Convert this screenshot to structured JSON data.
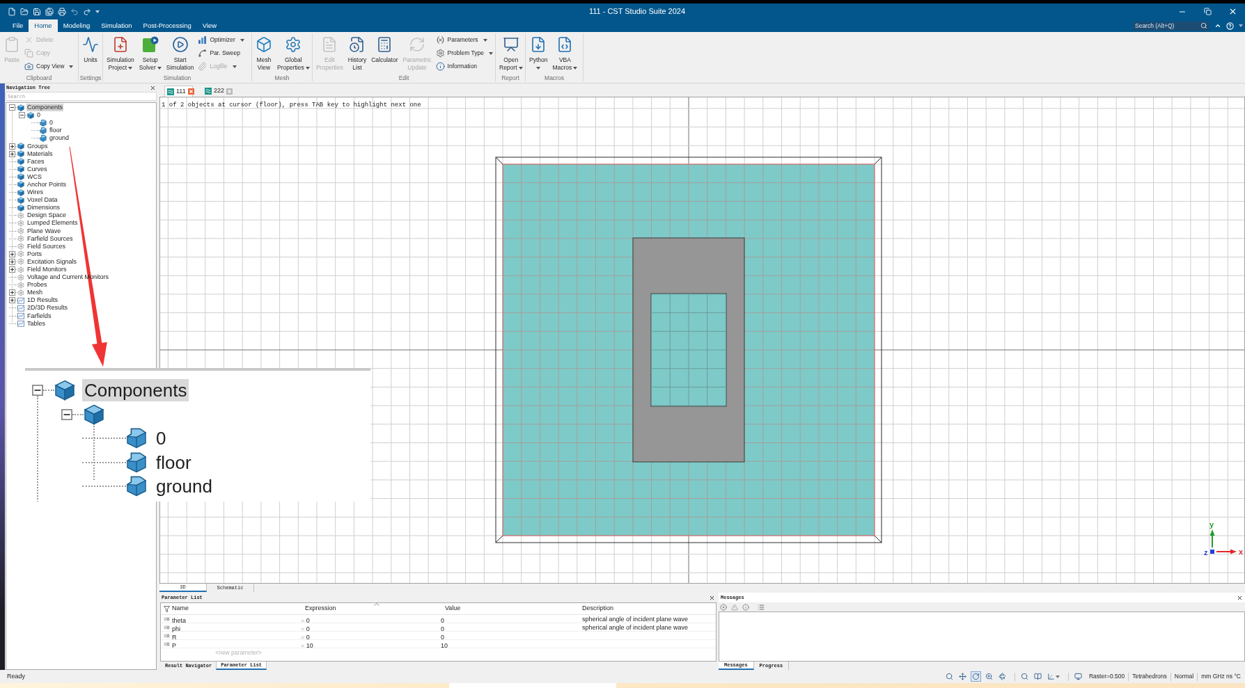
{
  "title_bar": {
    "title": "111 - CST Studio Suite 2024"
  },
  "menu_tabs": [
    {
      "label": "File",
      "selected": false
    },
    {
      "label": "Home",
      "selected": true
    },
    {
      "label": "Modeling",
      "selected": false
    },
    {
      "label": "Simulation",
      "selected": false
    },
    {
      "label": "Post-Processing",
      "selected": false
    },
    {
      "label": "View",
      "selected": false
    }
  ],
  "search": {
    "placeholder": "Search (Alt+Q)"
  },
  "ribbon": {
    "groups": [
      {
        "label": "Clipboard",
        "items": [
          {
            "kind": "large",
            "lines": [
              "Paste"
            ],
            "dropdown": false,
            "disabled": true
          },
          {
            "kind": "stack",
            "items": [
              {
                "label": "Delete",
                "dropdown": false,
                "disabled": true
              },
              {
                "label": "Copy",
                "dropdown": false,
                "disabled": true
              },
              {
                "label": "Copy View",
                "dropdown": true,
                "disabled": false
              }
            ]
          }
        ]
      },
      {
        "label": "Settings",
        "items": [
          {
            "kind": "large",
            "lines": [
              "Units"
            ],
            "dropdown": false,
            "disabled": false
          }
        ]
      },
      {
        "label": "Simulation",
        "items": [
          {
            "kind": "large",
            "lines": [
              "Simulation",
              "Project"
            ],
            "dropdown": true,
            "disabled": false
          },
          {
            "kind": "large",
            "lines": [
              "Setup",
              "Solver"
            ],
            "dropdown": true,
            "disabled": false
          },
          {
            "kind": "large",
            "lines": [
              "Start",
              "Simulation"
            ],
            "dropdown": false,
            "disabled": false
          },
          {
            "kind": "stack",
            "items": [
              {
                "label": "Optimizer",
                "dropdown": true,
                "disabled": false
              },
              {
                "label": "Par. Sweep",
                "dropdown": false,
                "disabled": false
              },
              {
                "label": "Logfile",
                "dropdown": true,
                "disabled": true
              }
            ]
          }
        ]
      },
      {
        "label": "Mesh",
        "items": [
          {
            "kind": "large",
            "lines": [
              "Mesh",
              "View"
            ],
            "dropdown": false,
            "disabled": false
          },
          {
            "kind": "large",
            "lines": [
              "Global",
              "Properties"
            ],
            "dropdown": true,
            "disabled": false
          }
        ]
      },
      {
        "label": "Edit",
        "items": [
          {
            "kind": "large",
            "lines": [
              "Edit",
              "Properties"
            ],
            "dropdown": false,
            "disabled": true
          },
          {
            "kind": "large",
            "lines": [
              "History",
              "List"
            ],
            "dropdown": false,
            "disabled": false
          },
          {
            "kind": "large",
            "lines": [
              "Calculator"
            ],
            "dropdown": false,
            "disabled": false
          },
          {
            "kind": "large",
            "lines": [
              "Parametric",
              "Update"
            ],
            "dropdown": false,
            "disabled": true
          },
          {
            "kind": "stack",
            "items": [
              {
                "label": "Parameters",
                "dropdown": true,
                "disabled": false
              },
              {
                "label": "Problem Type",
                "dropdown": true,
                "disabled": false
              },
              {
                "label": "Information",
                "dropdown": false,
                "disabled": false
              }
            ]
          }
        ]
      },
      {
        "label": "Report",
        "items": [
          {
            "kind": "large",
            "lines": [
              "Open",
              "Report"
            ],
            "dropdown": true,
            "disabled": false
          }
        ]
      },
      {
        "label": "Macros",
        "items": [
          {
            "kind": "large",
            "lines": [
              "Python"
            ],
            "dropdown": true,
            "disabled": false
          },
          {
            "kind": "large",
            "lines": [
              "VBA",
              "Macros"
            ],
            "dropdown": true,
            "disabled": false
          }
        ]
      }
    ]
  },
  "navigation_tree": {
    "title": "Navigation Tree",
    "search": {
      "placeholder": "Search"
    },
    "items": [
      {
        "label": "Components",
        "kind": "folder",
        "selected": true,
        "expanded": true,
        "children": [
          {
            "label": "0",
            "kind": "folder",
            "selected": false,
            "expanded": true,
            "children": [
              {
                "label": "0",
                "kind": "solid",
                "selected": false
              },
              {
                "label": "floor",
                "kind": "solid",
                "selected": false
              },
              {
                "label": "ground",
                "kind": "solid",
                "selected": false
              }
            ]
          }
        ]
      },
      {
        "label": "Groups",
        "kind": "folder",
        "selected": false,
        "expanded": false
      },
      {
        "label": "Materials",
        "kind": "folder",
        "selected": false,
        "expanded": false
      },
      {
        "label": "Faces",
        "kind": "folder",
        "selected": false
      },
      {
        "label": "Curves",
        "kind": "folder",
        "selected": false
      },
      {
        "label": "WCS",
        "kind": "folder",
        "selected": false
      },
      {
        "label": "Anchor Points",
        "kind": "folder",
        "selected": false
      },
      {
        "label": "Wires",
        "kind": "folder",
        "selected": false
      },
      {
        "label": "Voxel Data",
        "kind": "folder",
        "selected": false
      },
      {
        "label": "Dimensions",
        "kind": "folder",
        "selected": false
      },
      {
        "label": "Design Space",
        "kind": "setting",
        "selected": false
      },
      {
        "label": "Lumped Elements",
        "kind": "setting",
        "selected": false
      },
      {
        "label": "Plane Wave",
        "kind": "setting",
        "selected": false
      },
      {
        "label": "Farfield Sources",
        "kind": "setting",
        "selected": false
      },
      {
        "label": "Field Sources",
        "kind": "setting",
        "selected": false
      },
      {
        "label": "Ports",
        "kind": "setting",
        "selected": false,
        "expanded": false
      },
      {
        "label": "Excitation Signals",
        "kind": "setting",
        "selected": false,
        "expanded": false
      },
      {
        "label": "Field Monitors",
        "kind": "setting",
        "selected": false,
        "expanded": false
      },
      {
        "label": "Voltage and Current Monitors",
        "kind": "setting",
        "selected": false
      },
      {
        "label": "Probes",
        "kind": "setting",
        "selected": false
      },
      {
        "label": "Mesh",
        "kind": "setting",
        "selected": false,
        "expanded": false
      },
      {
        "label": "1D Results",
        "kind": "result",
        "selected": false,
        "expanded": false
      },
      {
        "label": "2D/3D Results",
        "kind": "result",
        "selected": false
      },
      {
        "label": "Farfields",
        "kind": "result",
        "selected": false
      },
      {
        "label": "Tables",
        "kind": "result",
        "selected": false
      }
    ]
  },
  "document_tabs": [
    {
      "label": "111",
      "selected": true
    },
    {
      "label": "222",
      "selected": false
    }
  ],
  "viewport": {
    "status_text": "1 of 2 objects at cursor (floor), press TAB key to highlight next one",
    "axes": [
      {
        "label": "y",
        "color": "#1f9e2a"
      },
      {
        "label": "z",
        "color": "#2a3fd6"
      },
      {
        "label": "x",
        "color": "#e5262b"
      }
    ]
  },
  "view_tabs": [
    {
      "label": "3D",
      "selected": true
    },
    {
      "label": "Schematic",
      "selected": false
    }
  ],
  "parameter_list": {
    "title": "Parameter List",
    "columns": [
      "Name",
      "Expression",
      "Value",
      "Description"
    ],
    "rows": [
      {
        "name": "theta",
        "sign": "=",
        "expression": "0",
        "value": "0",
        "description": "spherical angle of incident plane wave"
      },
      {
        "name": "phi",
        "sign": "=",
        "expression": "0",
        "value": "0",
        "description": "spherical angle of incident plane wave"
      },
      {
        "name": "R",
        "sign": "=",
        "expression": "0",
        "value": "0"
      },
      {
        "name": "P",
        "sign": "=",
        "expression": "10",
        "value": "10"
      }
    ],
    "new_row": {
      "placeholder": "<new parameter>"
    },
    "tabs": [
      {
        "label": "Result Navigator",
        "selected": false
      },
      {
        "label": "Parameter List",
        "selected": true
      }
    ]
  },
  "messages": {
    "title": "Messages",
    "tabs": [
      {
        "label": "Messages",
        "selected": true
      },
      {
        "label": "Progress",
        "selected": false
      }
    ]
  },
  "status_bar": {
    "text": "Ready",
    "view_tools": [
      {
        "selected": false
      },
      {
        "selected": false
      },
      {
        "selected": true
      },
      {
        "selected": false
      },
      {
        "selected": false
      },
      {
        "selected": false
      },
      {
        "selected": false
      },
      {
        "selected": false
      },
      {
        "selected": false
      }
    ],
    "fields": [
      "Raster=0.500",
      "Tetrahedrons",
      "Normal",
      "mm GHz ns °C"
    ]
  },
  "inset": {
    "items": [
      {
        "label": "Components",
        "selected": true,
        "expanded": true,
        "children": [
          {
            "expanded": true,
            "children": [
              {
                "label": "0",
                "selected": false
              },
              {
                "label": "floor",
                "selected": false
              },
              {
                "label": "ground",
                "selected": false
              }
            ]
          }
        ]
      }
    ]
  }
}
